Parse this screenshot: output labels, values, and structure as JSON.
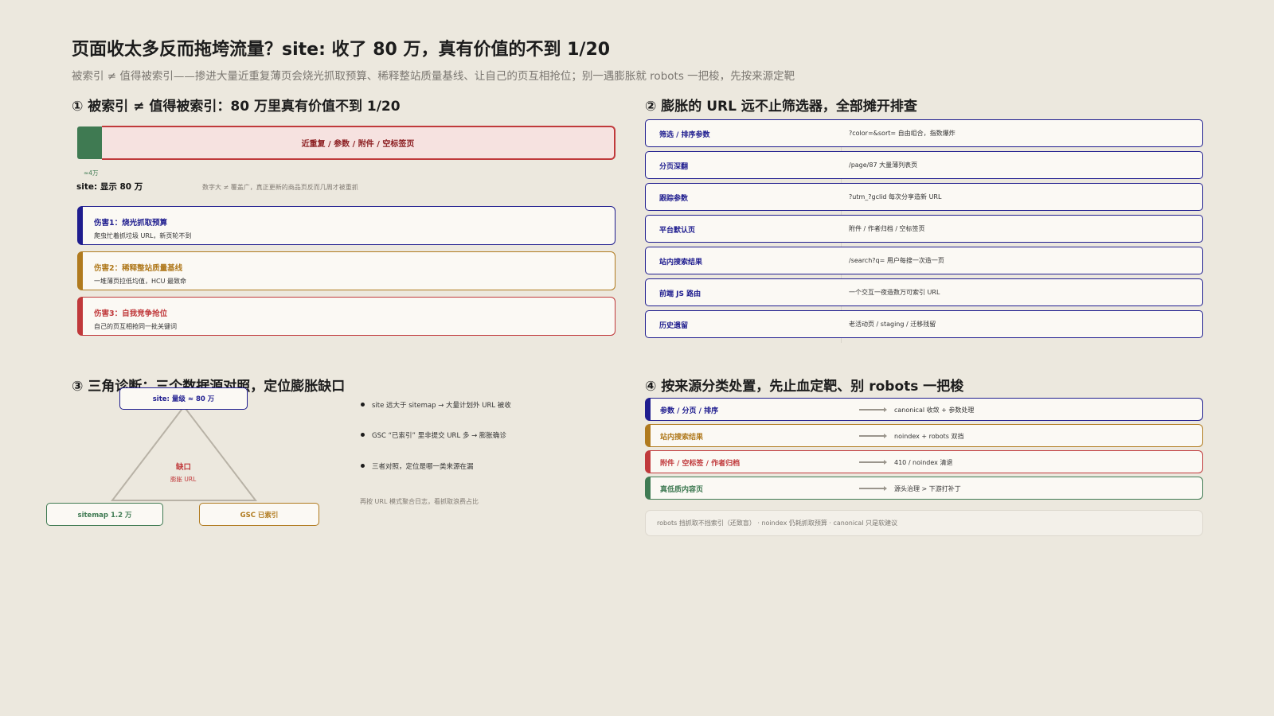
{
  "header": {
    "title": "页面收太多反而拖垮流量？site: 收了 80 万，真有价值的不到 1/20",
    "subtitle": "被索引 ≠ 值得被索引——掺进大量近重复薄页会烧光抓取预算、稀释整站质量基线、让自己的页互相抢位；别一遇膨胀就 robots 一把梭，先按来源定靶"
  },
  "section1": {
    "title": "① 被索引 ≠ 值得被索引：80 万里真有价值不到 1/20",
    "bar_label": "近重复 / 参数 / 附件 / 空标签页",
    "green_label": "≈4万",
    "site_label": "site: 显示 80 万",
    "note": "数字大 ≠ 覆盖广，真正更新的商品页反而几周才被重抓",
    "harms": [
      {
        "title": "伤害1：烧光抓取预算",
        "desc": "爬虫忙着抓垃圾 URL，新页轮不到"
      },
      {
        "title": "伤害2：稀释整站质量基线",
        "desc": "一堆薄页拉低均值，HCU 最致命"
      },
      {
        "title": "伤害3：自我竞争抢位",
        "desc": "自己的页互相抢同一批关键词"
      }
    ],
    "harm_colors": [
      "#1f1d8f",
      "#b07a1e",
      "#c0393b"
    ]
  },
  "section2": {
    "title": "② 膨胀的 URL 远不止筛选器，全部摊开排查",
    "rows": [
      {
        "label": "筛选 / 排序参数",
        "desc": "?color=&sort= 自由组合，指数爆炸"
      },
      {
        "label": "分页深翻",
        "desc": "/page/87 大量薄列表页"
      },
      {
        "label": "跟踪参数",
        "desc": "?utm_?gclid 每次分享造新 URL"
      },
      {
        "label": "平台默认页",
        "desc": "附件 / 作者归档 / 空标签页"
      },
      {
        "label": "站内搜索结果",
        "desc": "/search?q= 用户每搜一次造一页"
      },
      {
        "label": "前端 JS 路由",
        "desc": "一个交互一夜造数万可索引 URL"
      },
      {
        "label": "历史遗留",
        "desc": "老活动页 / staging / 迁移残留"
      }
    ]
  },
  "section3": {
    "title": "③ 三角诊断：三个数据源对照，定位膨胀缺口",
    "node_top": "site: 量级 ≈ 80 万",
    "node_left": "sitemap 1.2 万",
    "node_right": "GSC 已索引",
    "gap_main": "缺口",
    "gap_sub": "膨胀 URL",
    "bullets": [
      "site 远大于 sitemap → 大量计划外 URL 被收",
      "GSC “已索引” 里非提交 URL 多 → 膨胀确诊",
      "三者对照，定位是哪一类来源在漏"
    ],
    "note": "再按 URL 模式聚合日志，看抓取浪费占比"
  },
  "section4": {
    "title": "④ 按来源分类处置，先止血定靶、别 robots 一把梭",
    "rows": [
      {
        "label": "参数 / 分页 / 排序",
        "desc": "canonical 收敛 + 参数处理",
        "color": "#1f1d8f"
      },
      {
        "label": "站内搜索结果",
        "desc": "noindex + robots 双挡",
        "color": "#b07a1e"
      },
      {
        "label": "附件 / 空标签 / 作者归档",
        "desc": "410 / noindex 清退",
        "color": "#c0393b"
      },
      {
        "label": "真低质内容页",
        "desc": "源头治理 > 下游打补丁",
        "color": "#3f7a52"
      }
    ],
    "footnote": "robots 挡抓取不挡索引（还致盲） · noindex 仍耗抓取预算 · canonical 只是软建议"
  }
}
